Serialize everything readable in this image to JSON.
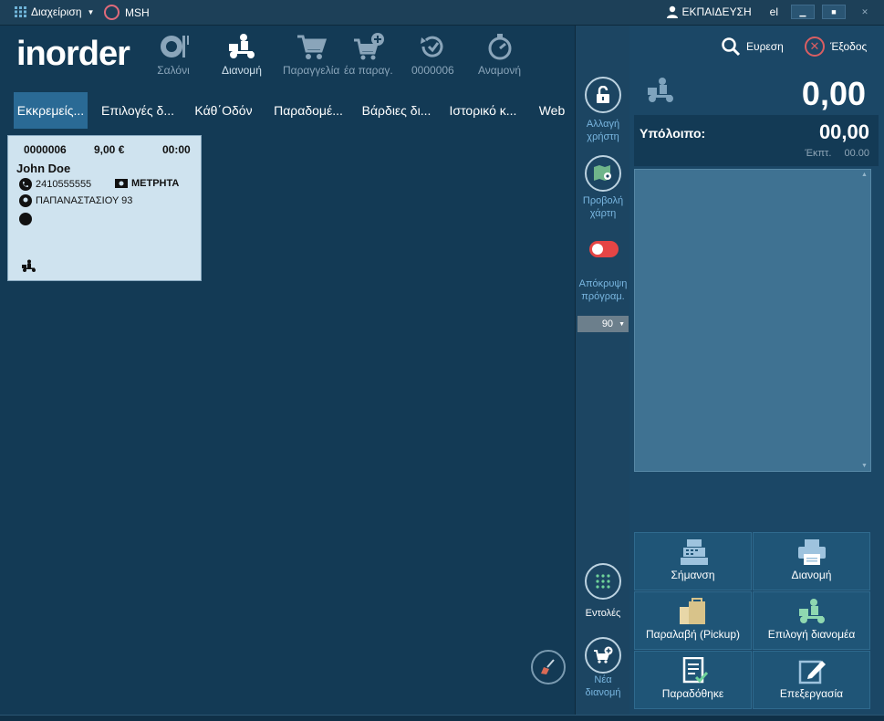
{
  "titlebar": {
    "menu_label": "Διαχείριση",
    "site_label": "MSH",
    "user_label": "ΕΚΠΑΙΔΕΥΣΗ",
    "lang": "el"
  },
  "logo": "inorder",
  "toolbar": {
    "items": [
      {
        "label": "Σαλόνι",
        "icon": "dining-icon"
      },
      {
        "label": "Διανομή",
        "icon": "delivery-scooter-icon"
      },
      {
        "label": "Παραγγελία",
        "icon": "cart-icon"
      },
      {
        "label": "έα παραγ.",
        "icon": "cart-add-icon"
      },
      {
        "label": "0000006",
        "icon": "history-icon"
      },
      {
        "label": "Αναμονή",
        "icon": "stopwatch-icon"
      }
    ]
  },
  "tabs": [
    "Εκκρεμείς...",
    "Επιλογές δ...",
    "Κάθ΄Οδόν",
    "Παραδομέ...",
    "Βάρδιες δι...",
    "Ιστορικό κ...",
    "Web"
  ],
  "order": {
    "number": "0000006",
    "amount": "9,00 €",
    "time": "00:00",
    "customer": "John Doe",
    "phone": "2410555555",
    "payment": "ΜΕΤΡΗΤΑ",
    "address": "ΠΑΠΑΝΑΣΤΑΣΙΟΥ 93"
  },
  "side": {
    "change_user": "Αλλαγή χρήστη",
    "map_view": "Προβολή χάρτη",
    "hide_prog": "Απόκρυψη πρόγραμ.",
    "select_value": "90",
    "commands": "Εντολές",
    "new_delivery": "Νέα διανομή"
  },
  "right": {
    "search": "Ευρεση",
    "exit": "Έξοδος",
    "total": "0,00",
    "balance_label": "Υπόλοιπο:",
    "balance_value": "00,00",
    "discount_label": "Έκπτ.",
    "discount_value": "00.00"
  },
  "actions": [
    {
      "label": "Σήμανση",
      "icon": "register-icon"
    },
    {
      "label": "Διανομή",
      "icon": "printer-icon"
    },
    {
      "label": "Παραλαβή (Pickup)",
      "icon": "bags-icon"
    },
    {
      "label": "Επιλογή διανομέα",
      "icon": "courier-icon"
    },
    {
      "label": "Παραδόθηκε",
      "icon": "delivered-doc-icon"
    },
    {
      "label": "Επεξεργασία",
      "icon": "edit-icon"
    }
  ]
}
